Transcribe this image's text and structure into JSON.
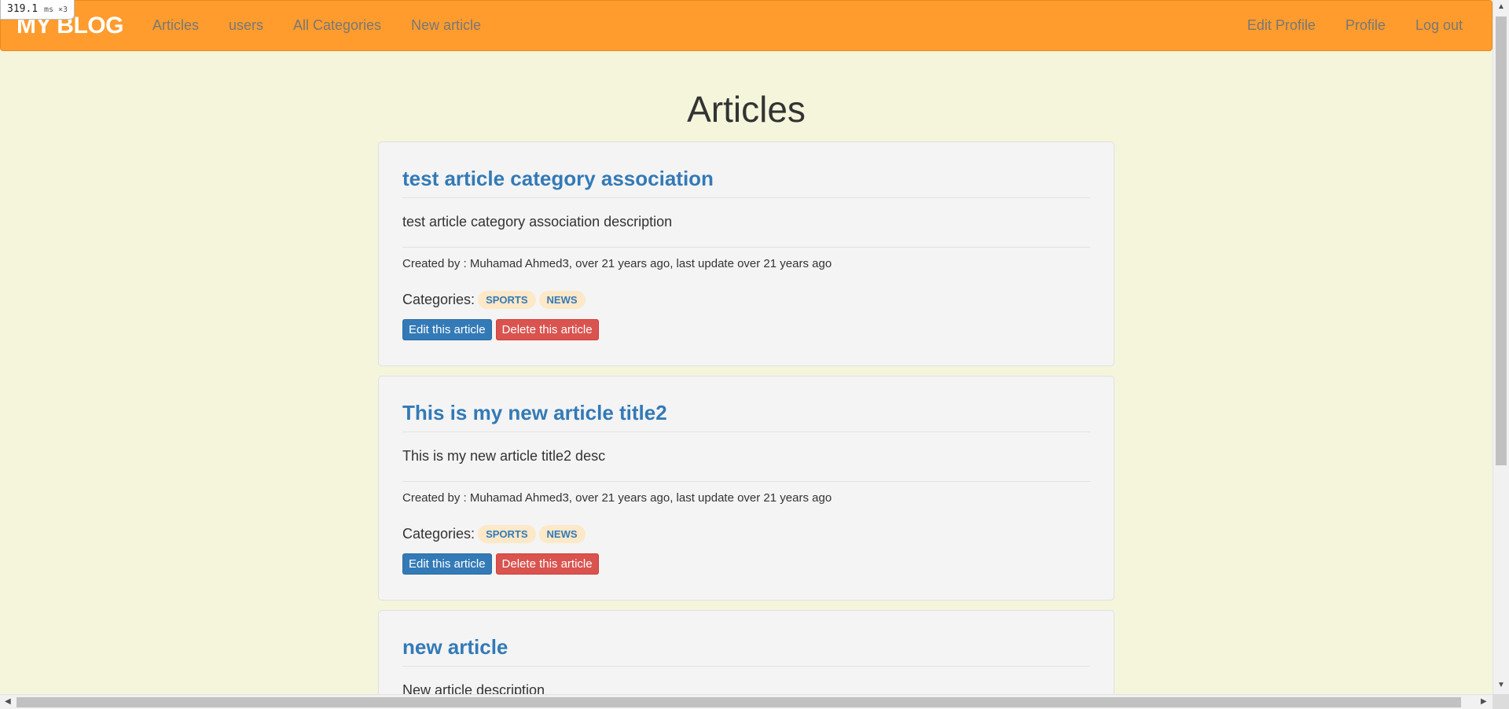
{
  "perf": {
    "value": "319.1",
    "unit": "ms ×3"
  },
  "navbar": {
    "brand": "MY BLOG",
    "left_links": [
      "Articles",
      "users",
      "All Categories",
      "New article"
    ],
    "right_links": [
      "Edit Profile",
      "Profile",
      "Log out"
    ]
  },
  "page": {
    "title": "Articles"
  },
  "articles": [
    {
      "title": "test article category association",
      "description": "test article category association description",
      "meta": "Created by : Muhamad Ahmed3, over 21 years ago, last update over 21 years ago",
      "categories_label": "Categories:",
      "categories": [
        "SPORTS",
        "NEWS"
      ],
      "edit_label": "Edit this article",
      "delete_label": "Delete this article"
    },
    {
      "title": "This is my new article title2",
      "description": "This is my new article title2 desc",
      "meta": "Created by : Muhamad Ahmed3, over 21 years ago, last update over 21 years ago",
      "categories_label": "Categories:",
      "categories": [
        "SPORTS",
        "NEWS"
      ],
      "edit_label": "Edit this article",
      "delete_label": "Delete this article"
    },
    {
      "title": "new article",
      "description": "New article description"
    }
  ],
  "scrollbar": {
    "up": "▲",
    "down": "▼",
    "left": "◀",
    "right": "▶"
  },
  "colors": {
    "navbar": "#ff9c2d",
    "background": "#f5f5dc",
    "link": "#337ab7",
    "danger": "#d9534f"
  }
}
